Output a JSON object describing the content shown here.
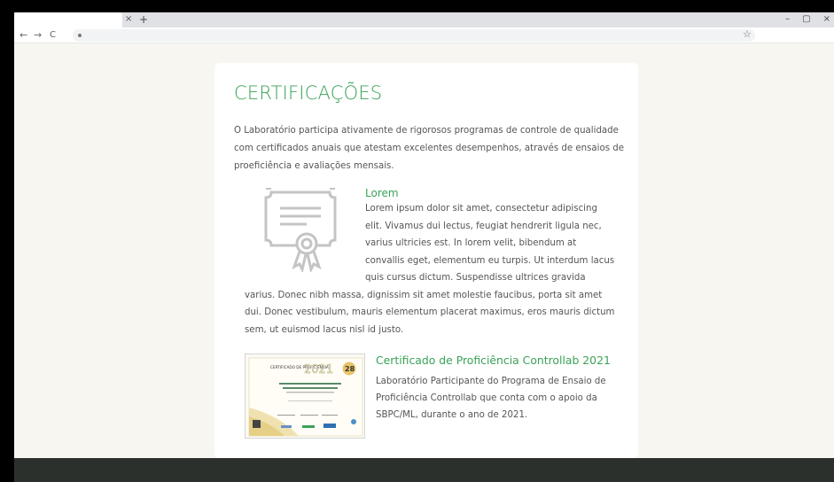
{
  "browser": {
    "tab_close": "×",
    "new_tab": "+",
    "minimize": "–",
    "maximize": "▢",
    "close": "×",
    "back": "←",
    "forward": "→",
    "reload": "C",
    "bookmark": "☆"
  },
  "page": {
    "title": "CERTIFICAÇÕES",
    "intro": "O Laboratório participa ativamente de rigorosos programas de controle de qualidade com certificados anuais que atestam excelentes desempenhos, através de ensaios de proeficiência e avaliações mensais."
  },
  "section1": {
    "title": "Lorem",
    "body": "Lorem ipsum dolor sit amet, consectetur adipiscing elit. Vivamus dui lectus, feugiat hendrerit ligula nec, varius ultricies est. In lorem velit, bibendum at convallis eget, elementum eu turpis. Ut interdum lacus quis cursus dictum. Suspendisse ultrices gravida varius. Donec nibh massa, dignissim sit amet molestie faucibus, porta sit amet dui. Donec vestibulum, mauris elementum placerat maximus, eros mauris dictum sem, ut euismod lacus nisl id justo.",
    "icon": "certificate-icon"
  },
  "section2": {
    "title": "Certificado de Proficiência Controllab 2021",
    "body": "Laboratório Participante do Programa de Ensaio de Proficiência Controllab que conta com o apoio da SBPC/ML, durante o ano de 2021.",
    "thumb": {
      "heading": "CERTIFICADO DE PROFICIÊNCIA",
      "year": "2021",
      "badge": "28"
    }
  },
  "colors": {
    "accent": "#3aa257",
    "text": "#555555",
    "page_bg": "#f7f6f0",
    "footer_bg": "#2b302c"
  }
}
